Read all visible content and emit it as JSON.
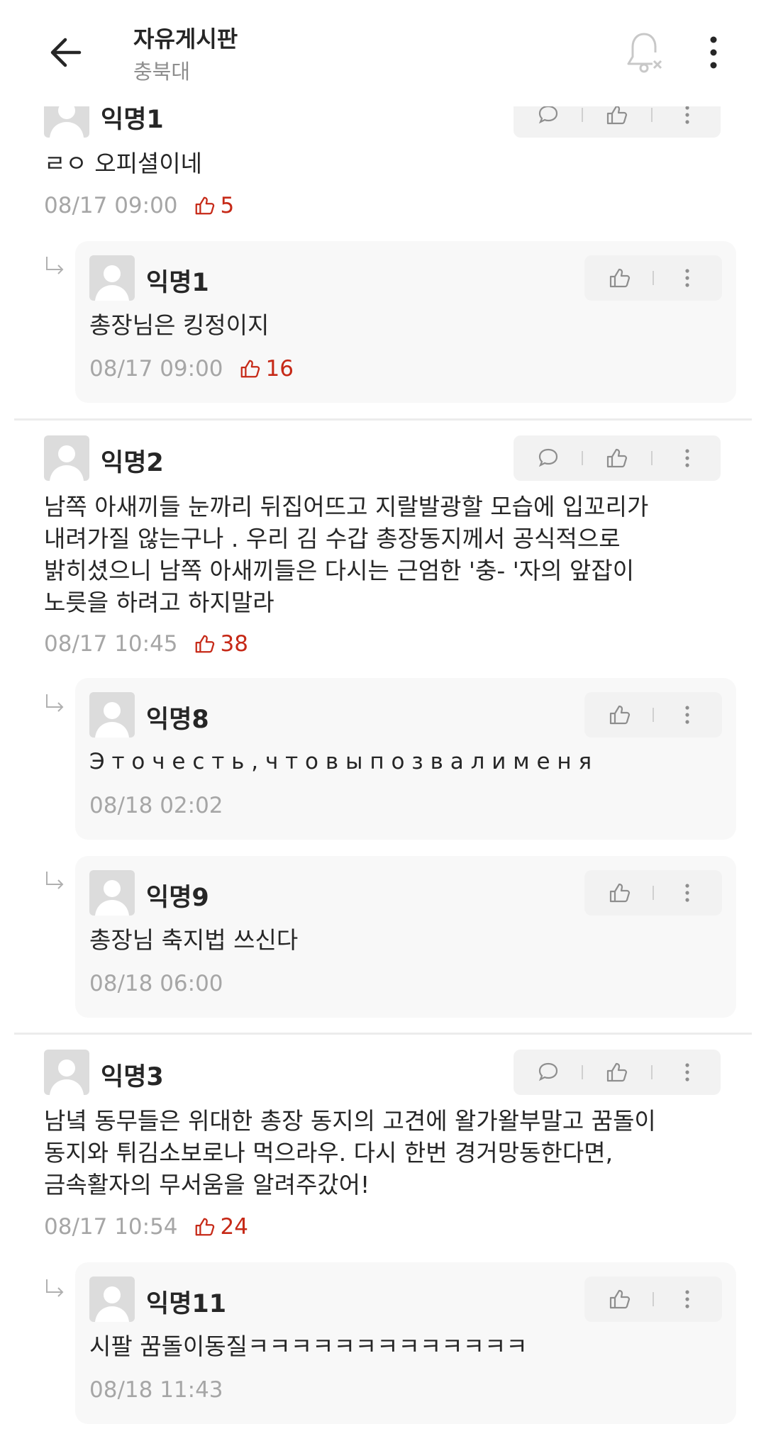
{
  "header": {
    "title": "자유게시판",
    "subtitle": "충북대"
  },
  "comments": [
    {
      "author": "익명1",
      "text": [
        "ㄹㅇ 오피셜이네"
      ],
      "date": "08/17 09:00",
      "likes": "5",
      "replies": [
        {
          "author": "익명1",
          "text": "총장님은 킹정이지",
          "date": "08/17 09:00",
          "likes": "16"
        }
      ]
    },
    {
      "author": "익명2",
      "text": [
        "남쪽 아새끼들 눈까리 뒤집어뜨고 지랄발광할 모습에 입꼬리가",
        "내려가질 않는구나 . 우리 김 수갑 총장동지께서 공식적으로",
        "밝히셨으니 남쪽 아새끼들은 다시는 근엄한 '충- '자의 앞잡이",
        "노릇을 하려고 하지말라"
      ],
      "date": "08/17 10:45",
      "likes": "38",
      "replies": [
        {
          "author": "익명8",
          "text": "Э т о  ч е с т ь ,  ч т о  в ы  п о з в а л и  м е н я",
          "date": "08/18 02:02",
          "likes": ""
        },
        {
          "author": "익명9",
          "text": "총장님 축지법 쓰신다",
          "date": "08/18 06:00",
          "likes": ""
        }
      ]
    },
    {
      "author": "익명3",
      "text": [
        "남녘 동무들은 위대한 총장 동지의 고견에 왈가왈부말고 꿈돌이",
        "동지와 튀김소보로나 먹으라우. 다시 한번 경거망동한다면,",
        "금속활자의 무서움을 알려주갔어!"
      ],
      "date": "08/17 10:54",
      "likes": "24",
      "replies": [
        {
          "author": "익명11",
          "text": "시팔 꿈돌이동질ㅋㅋㅋㅋㅋㅋㅋㅋㅋㅋㅋㅋㅋ",
          "date": "08/18 11:43",
          "likes": ""
        }
      ]
    }
  ],
  "colors": {
    "accent": "#c62917",
    "meta": "#a6a6a6",
    "action_bg": "#f2f2f2",
    "reply_bg": "#f8f8f8"
  }
}
